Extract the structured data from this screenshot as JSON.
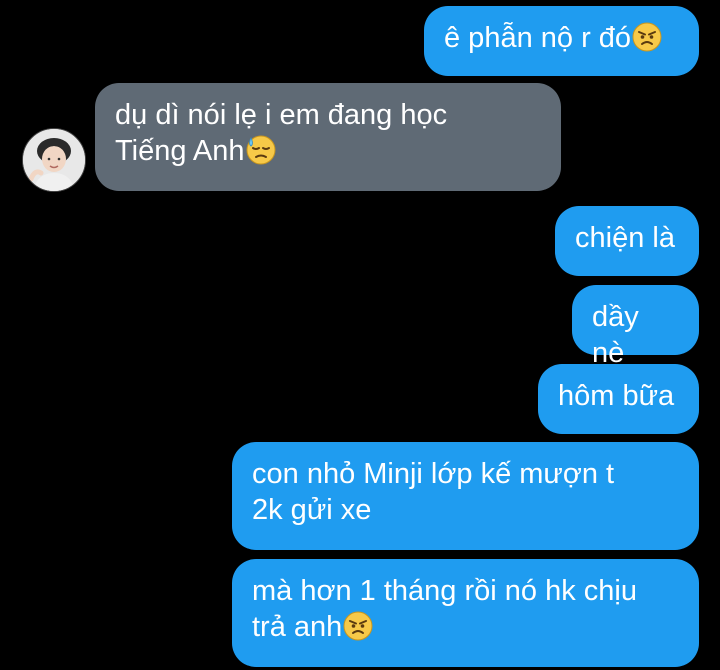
{
  "messages": [
    {
      "sender": "me",
      "text": "ê phẫn nộ r đó",
      "emoji": "angry-face"
    },
    {
      "sender": "other",
      "line1": "dụ dì nói lẹ i em đang học",
      "line2": "Tiếng Anh",
      "emoji": "downcast-sweat-face"
    },
    {
      "sender": "me",
      "text": "chiện là"
    },
    {
      "sender": "me",
      "text": "dầy nè"
    },
    {
      "sender": "me",
      "text": "hôm bữa"
    },
    {
      "sender": "me",
      "line1": "con nhỏ Minji lớp kế mượn t",
      "line2": "2k gửi xe"
    },
    {
      "sender": "me",
      "line1": "mà hơn 1 tháng rồi nó hk chịu",
      "line2": "trả anh",
      "emoji": "angry-face"
    }
  ],
  "colors": {
    "background": "#000000",
    "sent_bubble": "#1f9cf0",
    "received_bubble": "#5f6a75",
    "text": "#ffffff"
  }
}
